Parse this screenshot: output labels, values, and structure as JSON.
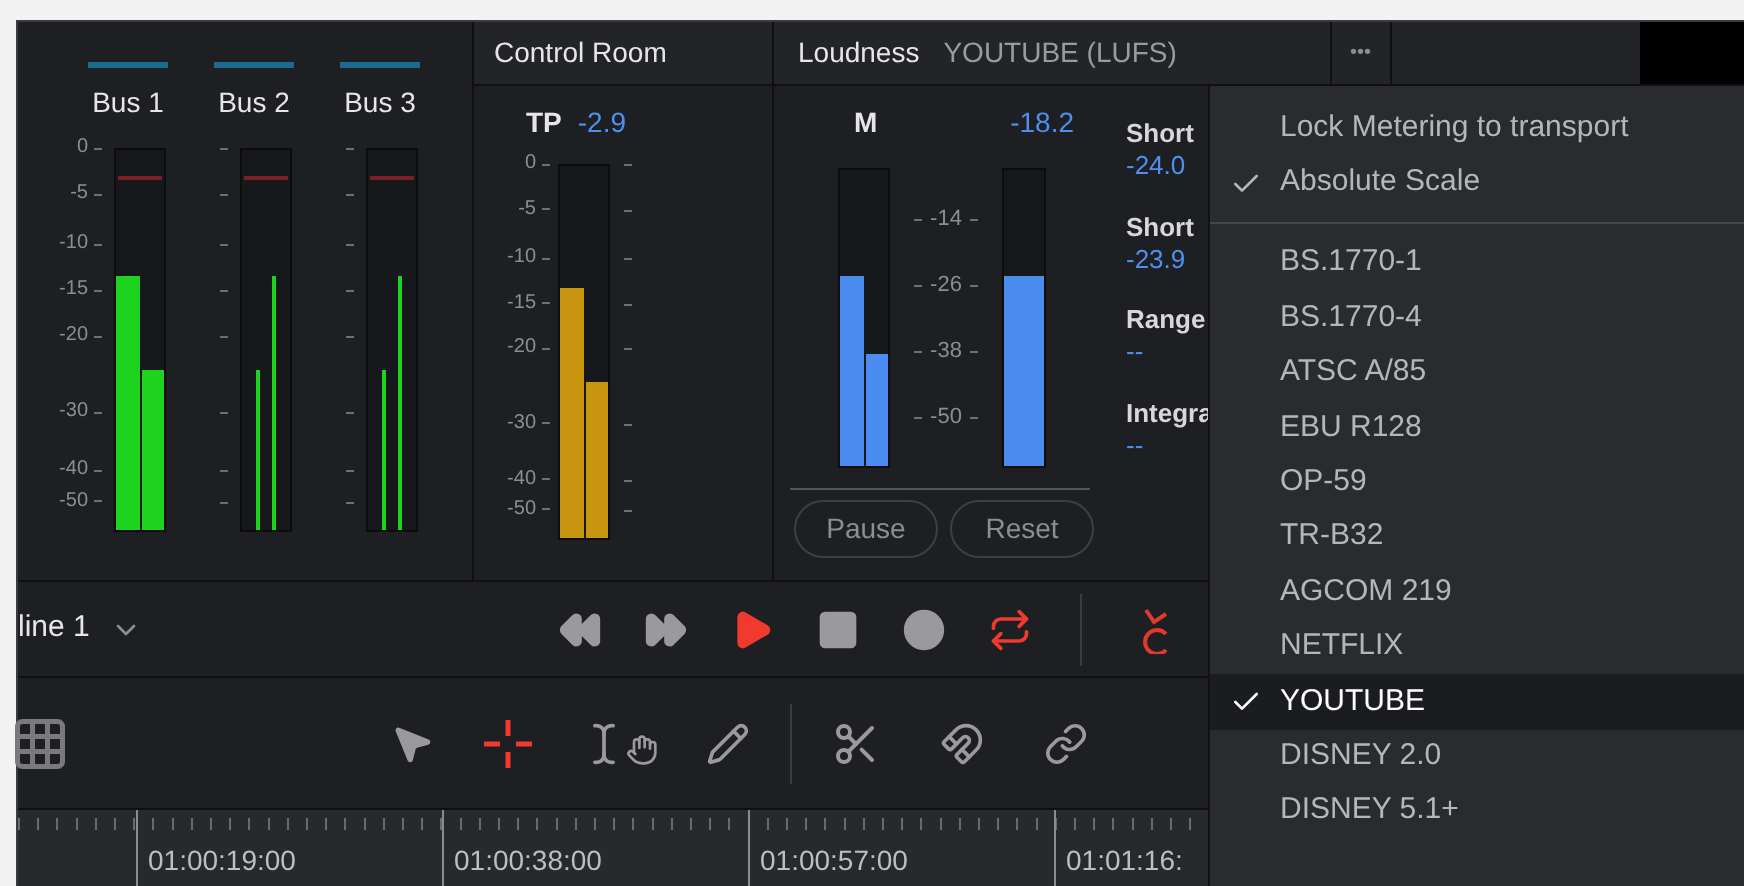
{
  "bus_meters": [
    {
      "label": "Bus 1",
      "kind": "wide",
      "channels": [
        {
          "level": 0.67
        },
        {
          "level": 0.42
        }
      ]
    },
    {
      "label": "Bus 2",
      "kind": "narrow",
      "channels": [
        {
          "level": 0.42
        },
        {
          "level": 0.67
        }
      ]
    },
    {
      "label": "Bus 3",
      "kind": "narrow",
      "channels": [
        {
          "level": 0.42
        },
        {
          "level": 0.67
        }
      ]
    }
  ],
  "bus_scale": [
    "0",
    "-5",
    "-10",
    "-15",
    "-20",
    "-30",
    "-40",
    "-50"
  ],
  "control_room": {
    "title": "Control Room",
    "tp_label": "TP",
    "tp_value": "-2.9",
    "scale": [
      "0",
      "-5",
      "-10",
      "-15",
      "-20",
      "-30",
      "-40",
      "-50"
    ],
    "channels": [
      {
        "level": 0.67
      },
      {
        "level": 0.42
      }
    ]
  },
  "loudness": {
    "title": "Loudness",
    "standard": "YOUTUBE (LUFS)",
    "m_label": "M",
    "m_value": "-18.2",
    "scale": [
      "-14",
      "-26",
      "-38",
      "-50"
    ],
    "m_channels": [
      {
        "level": 0.64
      },
      {
        "level": 0.38
      }
    ],
    "integrated": {
      "level": 0.64
    },
    "readings": [
      {
        "label": "Short",
        "value": "-24.0"
      },
      {
        "label": "Short",
        "value": "-23.9"
      },
      {
        "label": "Range",
        "value": "--"
      },
      {
        "label": "Integra",
        "value": "--"
      }
    ],
    "buttons": [
      "Pause",
      "Reset"
    ]
  },
  "more_button": "•••",
  "timeline_selector": "line 1",
  "transport": [
    {
      "kind": "rewind",
      "active": false
    },
    {
      "kind": "forward",
      "active": false
    },
    {
      "kind": "play",
      "active": true
    },
    {
      "kind": "stop",
      "active": false
    },
    {
      "kind": "record",
      "active": false
    },
    {
      "kind": "loop",
      "active": true
    }
  ],
  "tools": [
    {
      "kind": "pointer",
      "selected": false
    },
    {
      "kind": "crosshair",
      "selected": true
    },
    {
      "kind": "trim",
      "selected": false
    },
    {
      "kind": "pencil",
      "selected": false
    },
    {
      "kind": "scissors",
      "selected": false
    },
    {
      "kind": "magnet",
      "selected": false
    },
    {
      "kind": "link",
      "selected": false
    }
  ],
  "ruler": [
    "01:00:19:00",
    "01:00:38:00",
    "01:00:57:00",
    "01:01:16:"
  ],
  "menu": {
    "options": [
      {
        "label": "Lock Metering to transport",
        "checked": false
      },
      {
        "label": "Absolute Scale",
        "checked": true
      }
    ],
    "standards": [
      {
        "label": "BS.1770-1",
        "selected": false
      },
      {
        "label": "BS.1770-4",
        "selected": false
      },
      {
        "label": "ATSC A/85",
        "selected": false
      },
      {
        "label": "EBU R128",
        "selected": false
      },
      {
        "label": "OP-59",
        "selected": false
      },
      {
        "label": "TR-B32",
        "selected": false
      },
      {
        "label": "AGCOM 219",
        "selected": false
      },
      {
        "label": "NETFLIX",
        "selected": false
      },
      {
        "label": "YOUTUBE",
        "selected": true
      },
      {
        "label": "DISNEY 2.0",
        "selected": false
      },
      {
        "label": "DISNEY 5.1+",
        "selected": false
      }
    ]
  }
}
